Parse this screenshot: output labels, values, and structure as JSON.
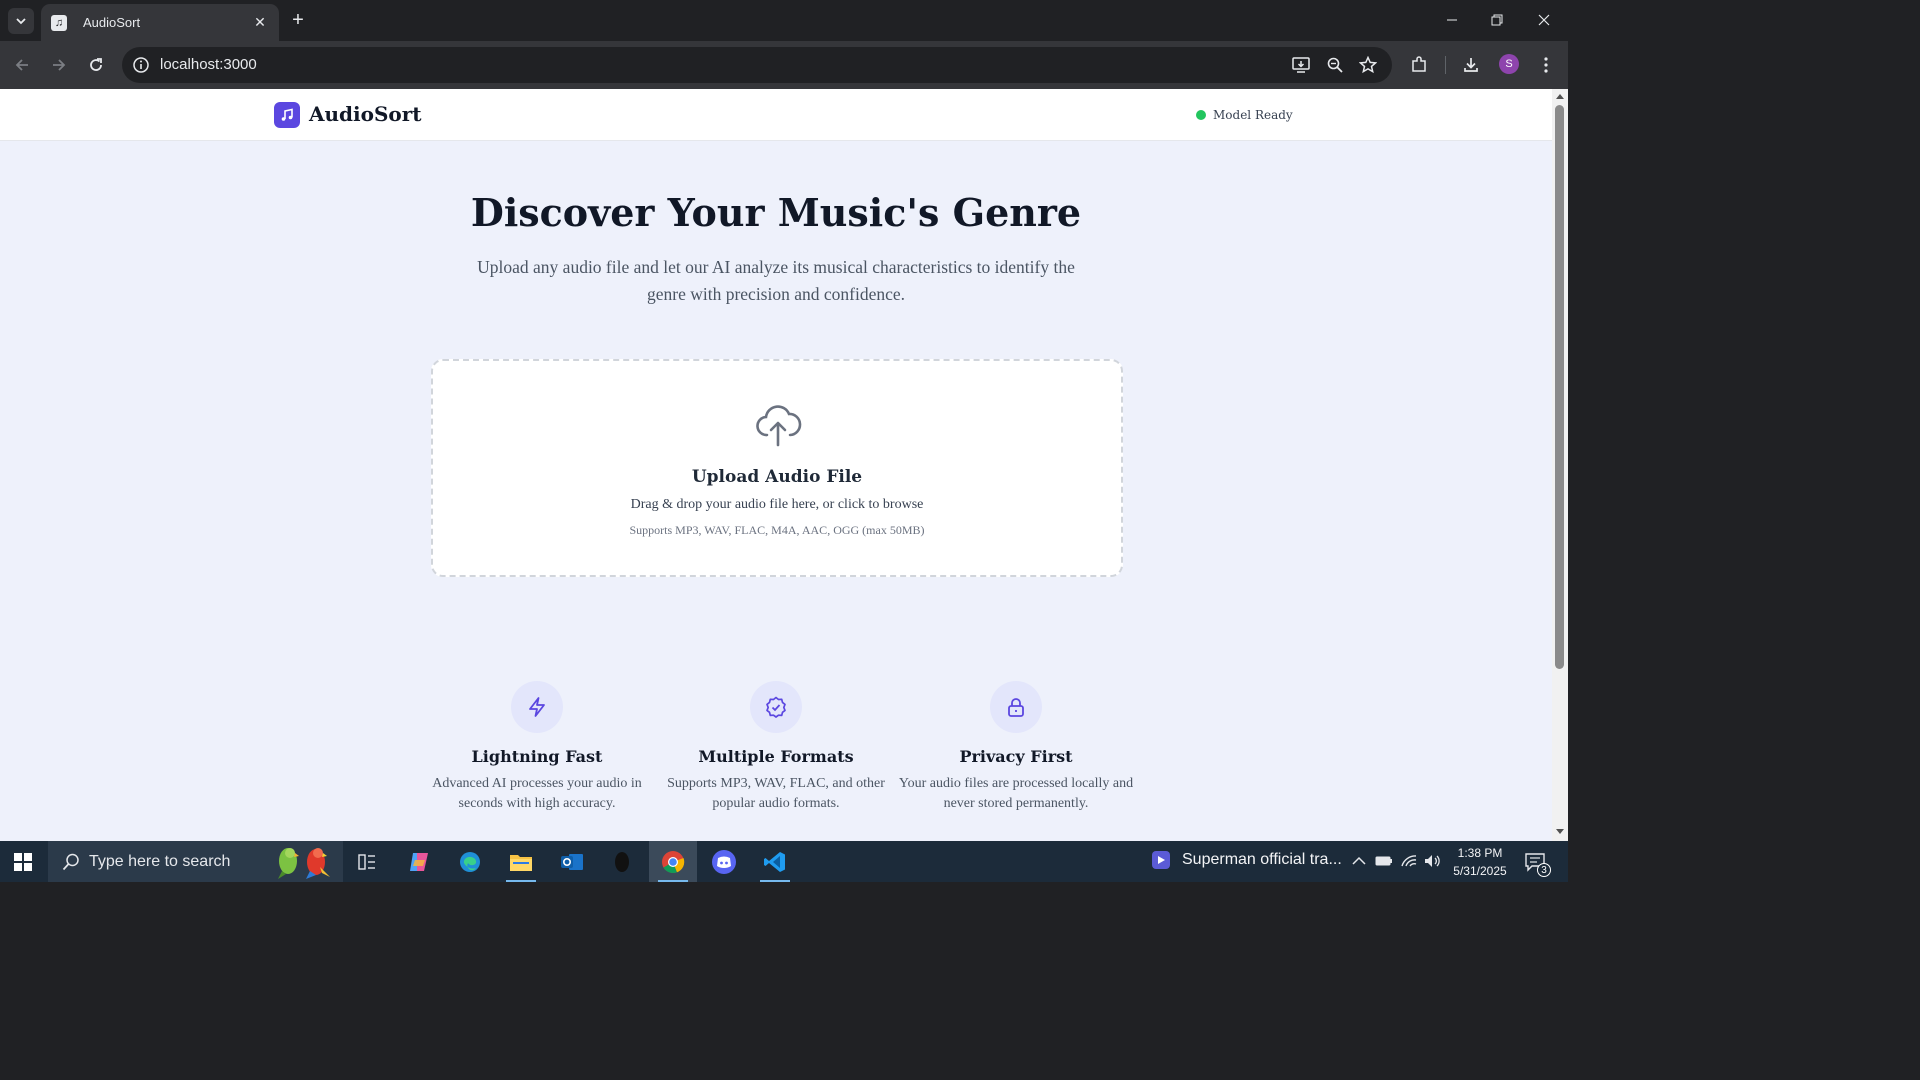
{
  "browser": {
    "tab_title": "AudioSort",
    "url": "localhost:3000",
    "profile_initial": "S"
  },
  "site": {
    "brand": "AudioSort",
    "status_label": "Model Ready",
    "status_color": "#22c55e",
    "accent_color": "#5b47e0"
  },
  "hero": {
    "title": "Discover Your Music's Genre",
    "subtitle": "Upload any audio file and let our AI analyze its musical characteristics to identify the genre with precision and confidence."
  },
  "upload": {
    "icon": "cloud-upload-icon",
    "title": "Upload Audio File",
    "description": "Drag & drop your audio file here, or click to browse",
    "formats": "Supports MP3, WAV, FLAC, M4A, AAC, OGG (max 50MB)"
  },
  "features": [
    {
      "icon": "lightning-icon",
      "title": "Lightning Fast",
      "description": "Advanced AI processes your audio in seconds with high accuracy."
    },
    {
      "icon": "check-badge-icon",
      "title": "Multiple Formats",
      "description": "Supports MP3, WAV, FLAC, and other popular audio formats."
    },
    {
      "icon": "lock-icon",
      "title": "Privacy First",
      "description": "Your audio files are processed locally and never stored permanently."
    }
  ],
  "taskbar": {
    "search_placeholder": "Type here to search",
    "media_title": "Superman official tra...",
    "time": "1:38 PM",
    "date": "5/31/2025",
    "notification_count": "3"
  }
}
